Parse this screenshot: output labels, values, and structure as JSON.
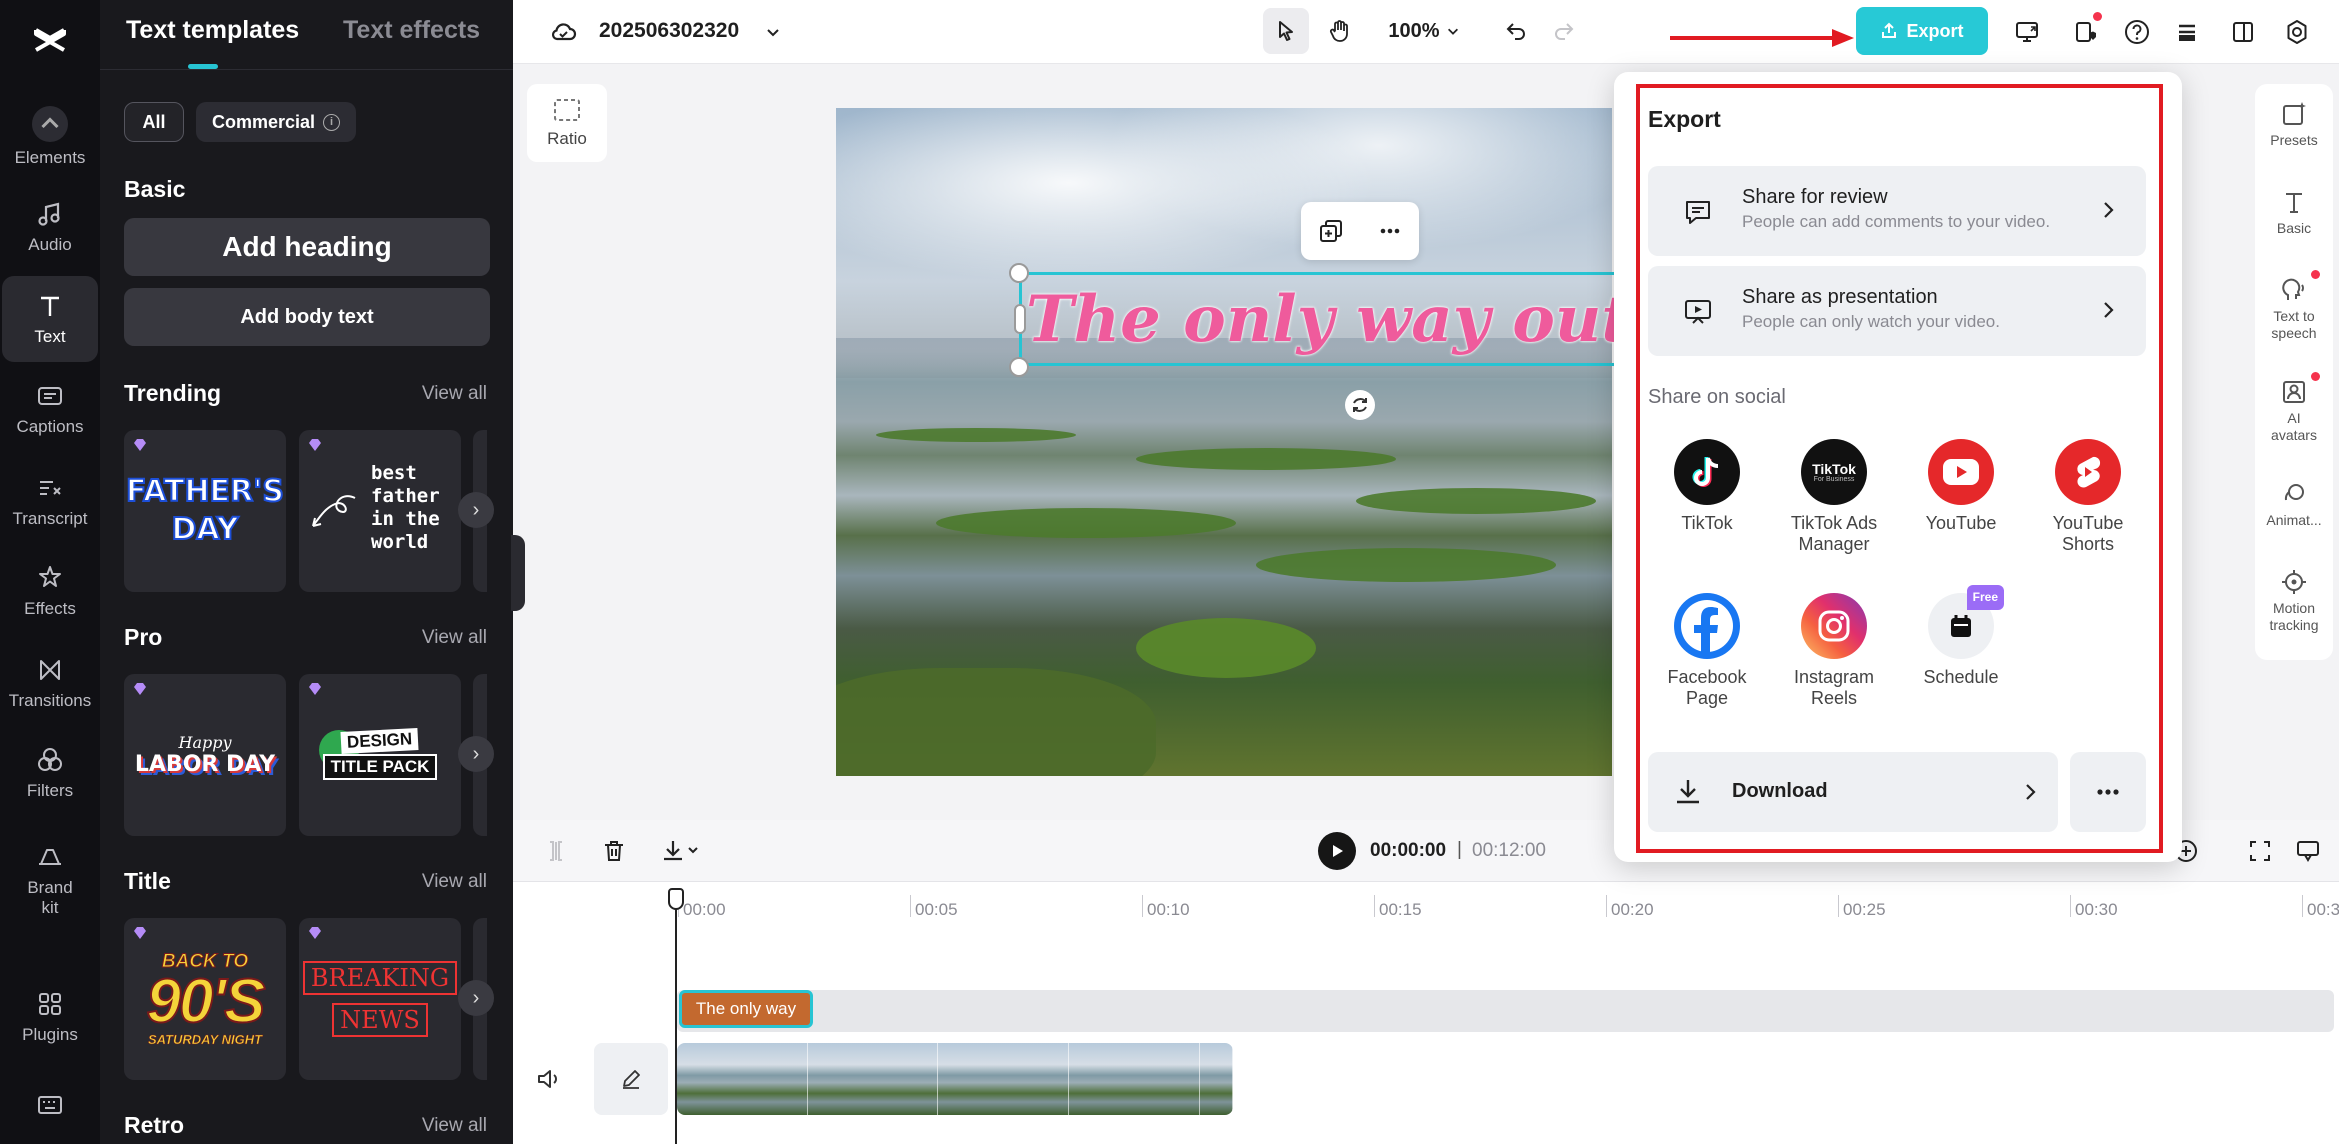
{
  "rail": {
    "items": [
      {
        "label": "Elements",
        "icon": "elements-icon"
      },
      {
        "label": "Audio",
        "icon": "music-note-icon"
      },
      {
        "label": "Text",
        "icon": "text-icon",
        "active": true
      },
      {
        "label": "Captions",
        "icon": "captions-icon"
      },
      {
        "label": "Transcript",
        "icon": "transcript-icon"
      },
      {
        "label": "Effects",
        "icon": "effects-icon"
      },
      {
        "label": "Transitions",
        "icon": "transitions-icon"
      },
      {
        "label": "Filters",
        "icon": "filters-icon"
      },
      {
        "label": "Brand\nkit",
        "icon": "brand-kit-icon"
      },
      {
        "label": "Plugins",
        "icon": "plugins-icon"
      }
    ]
  },
  "panel": {
    "tabs": [
      "Text templates",
      "Text effects"
    ],
    "filters": {
      "all": "All",
      "commercial": "Commercial"
    },
    "basic": {
      "title": "Basic",
      "add_heading": "Add heading",
      "add_body": "Add body text"
    },
    "sections": [
      {
        "title": "Trending",
        "view_all": "View all"
      },
      {
        "title": "Pro",
        "view_all": "View all"
      },
      {
        "title": "Title",
        "view_all": "View all"
      },
      {
        "title": "Retro",
        "view_all": "View all"
      }
    ],
    "cards": {
      "fathers_day": [
        "FATHER'S",
        "DAY"
      ],
      "best_father": [
        "best",
        "father",
        "in the",
        "world"
      ],
      "labor_day": [
        "Happy",
        "LABOR DAY"
      ],
      "design_pack": [
        "DESIGN",
        "TITLE PACK"
      ],
      "back_90s": [
        "BACK TO",
        "90'S",
        "SATURDAY NIGHT"
      ],
      "breaking": [
        "BREAKING",
        "NEWS"
      ]
    }
  },
  "topbar": {
    "project_name": "202506302320",
    "zoom": "100%",
    "export_label": "Export"
  },
  "canvas": {
    "ratio_label": "Ratio",
    "overlay_text": "The only way out is through"
  },
  "export_panel": {
    "title": "Export",
    "share_review": {
      "title": "Share for review",
      "subtitle": "People can add comments to your video."
    },
    "share_presentation": {
      "title": "Share as presentation",
      "subtitle": "People can only watch your video."
    },
    "social_label": "Share on social",
    "social": [
      {
        "label": "TikTok"
      },
      {
        "label": "TikTok Ads\nManager",
        "logo_text": "TikTok",
        "logo_sub": "For Business"
      },
      {
        "label": "YouTube"
      },
      {
        "label": "YouTube\nShorts"
      },
      {
        "label": "Facebook\nPage"
      },
      {
        "label": "Instagram\nReels"
      },
      {
        "label": "Schedule",
        "tag": "Free"
      }
    ],
    "download_label": "Download"
  },
  "right_rail": [
    {
      "label": "Presets"
    },
    {
      "label": "Basic"
    },
    {
      "label": "Text to\nspeech"
    },
    {
      "label": "AI\navatars"
    },
    {
      "label": "Animat..."
    },
    {
      "label": "Motion\ntracking"
    }
  ],
  "timeline": {
    "current_time": "00:00:00",
    "separator": "|",
    "total_time": "00:12:00",
    "ruler": [
      "00:00",
      "00:05",
      "00:10",
      "00:15",
      "00:20",
      "00:25",
      "00:30",
      "00:3"
    ],
    "text_clip": "The only way"
  },
  "colors": {
    "accent": "#27c9d6",
    "annotation": "#e11b22",
    "overlay_text": "#ef5b9c",
    "text_clip": "#c3692f"
  }
}
